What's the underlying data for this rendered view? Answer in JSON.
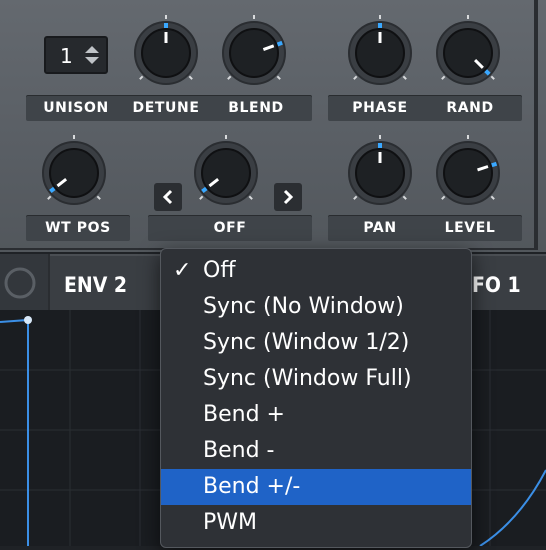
{
  "oscillator": {
    "unison_value": "1",
    "labels": {
      "unison": "UNISON",
      "detune": "DETUNE",
      "blend": "BLEND",
      "phase": "PHASE",
      "rand": "RAND",
      "wt_pos": "WT POS",
      "warp_mode": "OFF",
      "pan": "PAN",
      "level": "LEVEL"
    }
  },
  "tabs": {
    "env2": "ENV 2",
    "lfo1": "FO 1"
  },
  "menu": {
    "items": [
      {
        "label": "Off",
        "checked": "✓"
      },
      {
        "label": "Sync (No Window)"
      },
      {
        "label": "Sync (Window 1/2)"
      },
      {
        "label": "Sync (Window Full)"
      },
      {
        "label": "Bend +"
      },
      {
        "label": "Bend -"
      },
      {
        "label": "Bend +/-"
      },
      {
        "label": "PWM"
      }
    ],
    "highlighted": "Bend +/-"
  },
  "colors": {
    "accent": "#1f63c7",
    "knob_tick": "#3aa8ff",
    "graph_line": "#3b8fe6"
  }
}
